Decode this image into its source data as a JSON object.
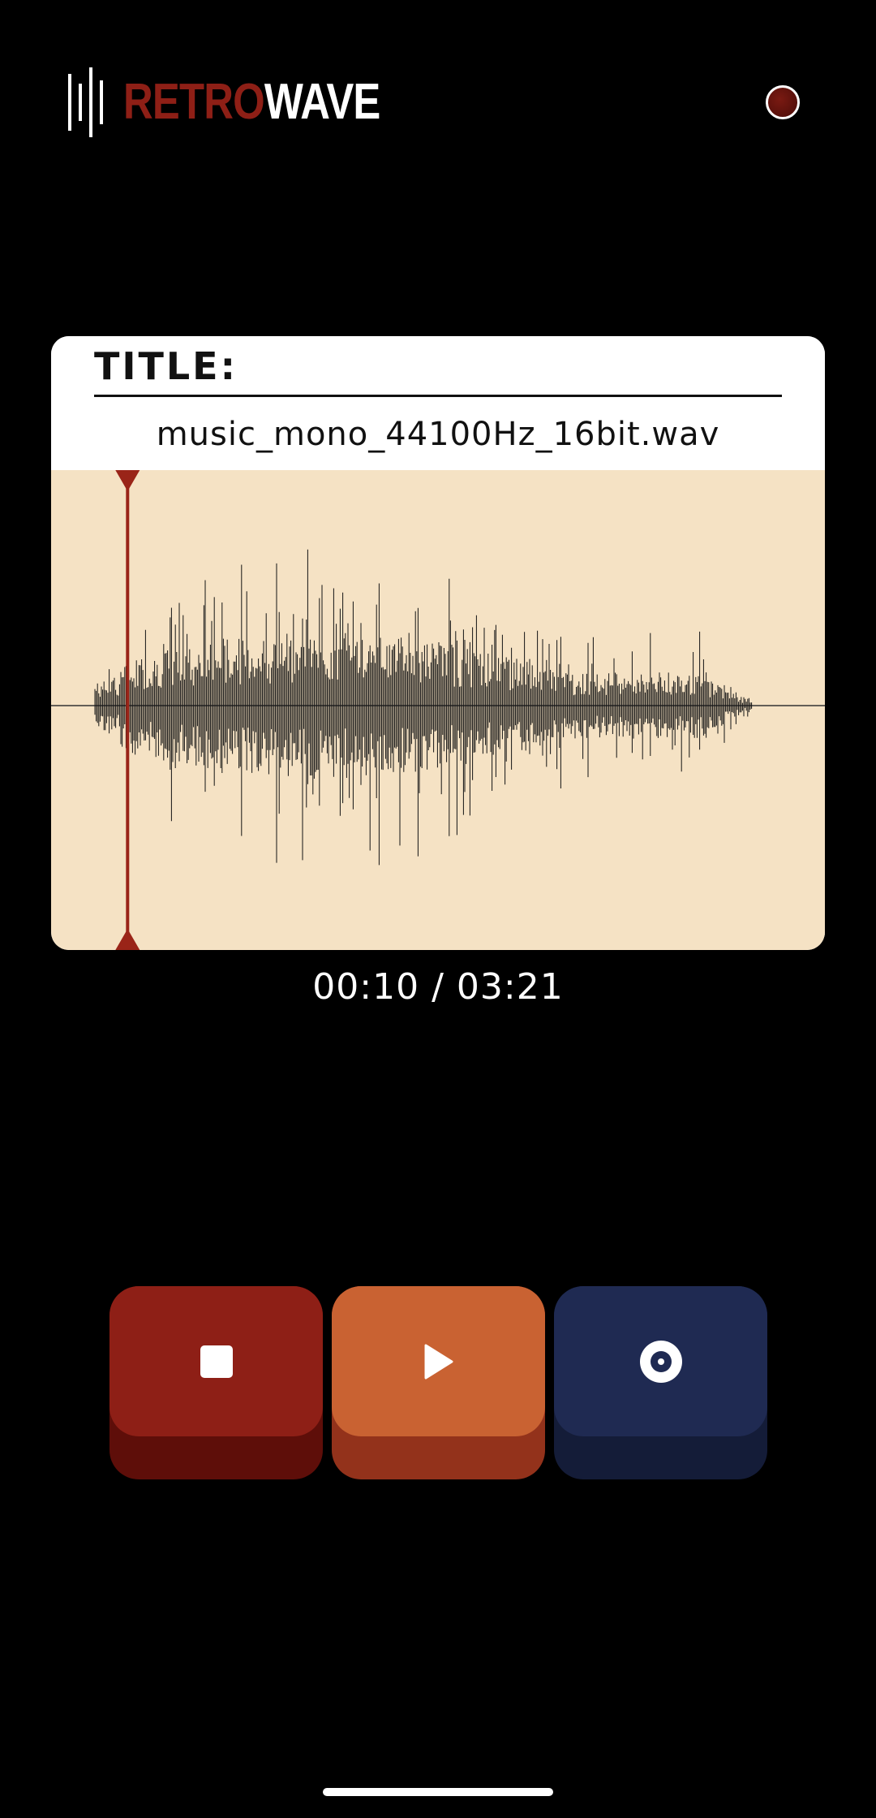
{
  "app": {
    "logo_part1": "RETRO",
    "logo_part2": "WAVE",
    "logo_icon": "sound-bars-icon",
    "record_indicator_icon": "record-dot-icon"
  },
  "track": {
    "title_label": "TITLE:",
    "file_name": "music_mono_44100Hz_16bit.wav"
  },
  "playback": {
    "time_display": "00:10 / 03:21",
    "playhead_position": 0.0498
  },
  "controls": [
    {
      "name": "stop",
      "icon": "stop-icon"
    },
    {
      "name": "play",
      "icon": "play-icon"
    },
    {
      "name": "record",
      "icon": "record-icon"
    }
  ],
  "colors": {
    "background": "#000000",
    "brand_red": "#8e1f16",
    "waveform_bg": "#f5e2c4",
    "playhead": "#9a2418",
    "stop_button": "#8e1f16",
    "play_button": "#c96232",
    "record_button": "#1f2a52"
  }
}
